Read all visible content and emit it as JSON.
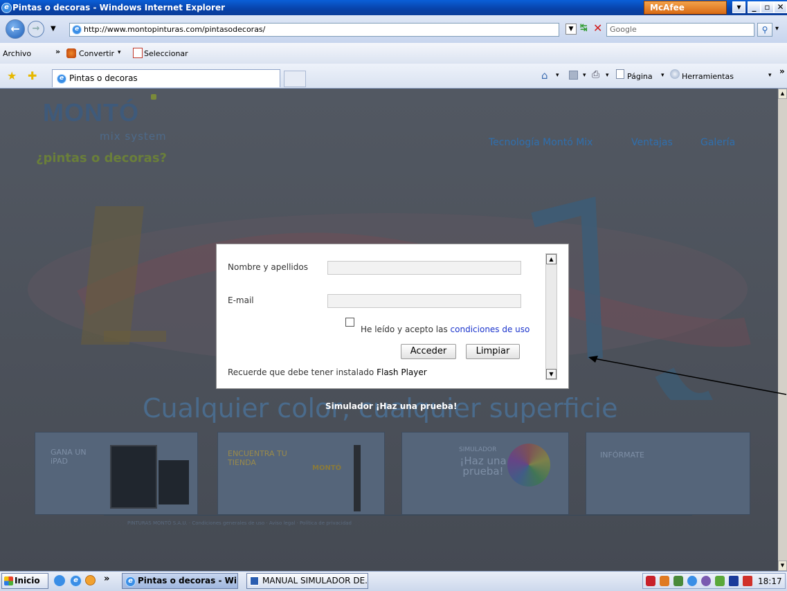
{
  "window": {
    "title": "Pintas o decoras - Windows Internet Explorer",
    "mcafee": "McAfee"
  },
  "address": {
    "url": "http://www.montopinturas.com/pintasodecoras/",
    "search_placeholder": "Google"
  },
  "menu": {
    "archivo": "Archivo",
    "convertir": "Convertir",
    "seleccionar": "Seleccionar",
    "chevron": "»"
  },
  "tab": {
    "label": "Pintas o decoras"
  },
  "commandbar": {
    "pagina": "Página",
    "herramientas": "Herramientas"
  },
  "site": {
    "logo": "MONTÓ",
    "logo_sub": "mix system",
    "tagline": "¿pintas o decoras?",
    "nav": [
      "Tecnología Montó Mix",
      "Ventajas",
      "Galería"
    ],
    "headline": "Cualquier color, cualquier superficie",
    "simulator_label": "Simulador ¡Haz una prueba!",
    "banners": [
      {
        "text": "GANA UN iPAD"
      },
      {
        "text": "ENCUENTRA TU TIENDA",
        "sub": "MONTÓ"
      },
      {
        "text": "SIMULADOR",
        "big": "¡Haz una prueba!"
      },
      {
        "text": "INFÓRMATE"
      }
    ],
    "footer": "PINTURAS MONTÓ S.A.U. · Condiciones generales de uso · Aviso legal · Política de privacidad"
  },
  "dialog": {
    "name_label": "Nombre y apellidos",
    "name_value": "",
    "email_label": "E-mail",
    "email_value": "",
    "terms_prefix": "He leído y acepto las",
    "terms_link": "condiciones de uso",
    "accept_btn": "Acceder",
    "clear_btn": "Limpiar",
    "flash_prefix": "Recuerde que debe tener instalado",
    "flash_name": "Flash Player"
  },
  "taskbar": {
    "start": "Inicio",
    "task1": "Pintas o decoras - Wi...",
    "task2": "MANUAL SIMULADOR DE...",
    "clock": "18:17"
  }
}
